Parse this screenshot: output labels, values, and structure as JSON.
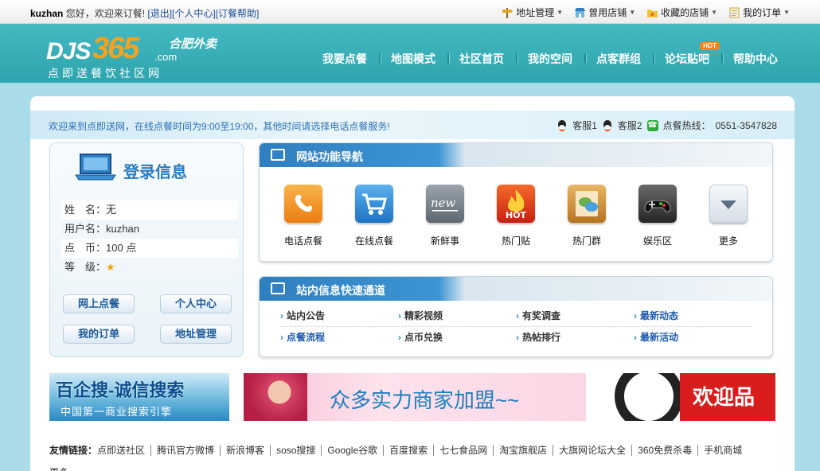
{
  "topbar": {
    "username": "kuzhan",
    "greeting": "您好，欢迎来订餐!",
    "links": [
      "[退出]",
      "[个人中心]",
      "[订餐帮助]"
    ],
    "tools": [
      {
        "label": "地址管理",
        "icon": "signpost-icon"
      },
      {
        "label": "曾用店铺",
        "icon": "shop-icon"
      },
      {
        "label": "收藏的店铺",
        "icon": "favorite-folder-icon"
      },
      {
        "label": "我的订单",
        "icon": "order-list-icon"
      }
    ]
  },
  "logo": {
    "djs": "DJS",
    "n365": "365",
    "com": ".com",
    "city": "合肥外卖",
    "slogan": "点即送餐饮社区网"
  },
  "nav": {
    "items": [
      "我要点餐",
      "地图模式",
      "社区首页",
      "我的空间",
      "点客群组",
      "论坛贴吧",
      "帮助中心"
    ],
    "hot_badge": "HOT"
  },
  "welcome": {
    "message": "欢迎来到点即送网，在线点餐时间为9:00至19:00，其他时间请选择电话点餐服务!",
    "service1": "客服1",
    "service2": "客服2",
    "hotline_label": "点餐热线：",
    "hotline": "0551-3547828"
  },
  "login": {
    "title": "登录信息",
    "name_label": "姓　名：",
    "name_value": "无",
    "user_label": "用户名：",
    "user_value": "kuzhan",
    "coin_label": "点　币：",
    "coin_value": "100 点",
    "level_label": "等　级：",
    "level_stars": 1,
    "buttons": [
      "网上点餐",
      "个人中心",
      "我的订单",
      "地址管理"
    ]
  },
  "functions": {
    "title": "网站功能导航",
    "items": [
      {
        "label": "电话点餐",
        "icon": "phone-icon",
        "color": "#f39a1c"
      },
      {
        "label": "在线点餐",
        "icon": "cart-icon",
        "color": "#2f8fd6"
      },
      {
        "label": "新鲜事",
        "icon": "new-icon",
        "color": "#7c8892"
      },
      {
        "label": "热门贴",
        "icon": "hot-flame-icon",
        "color": "#e23a1c"
      },
      {
        "label": "热门群",
        "icon": "chat-book-icon",
        "color": "#d48b2a"
      },
      {
        "label": "娱乐区",
        "icon": "gamepad-icon",
        "color": "#3b3b3b"
      },
      {
        "label": "更多",
        "icon": "more-down-icon",
        "color": "#dfe6ee"
      }
    ]
  },
  "quick": {
    "title": "站内信息快速通道",
    "rows": [
      [
        "站内公告",
        "精彩视频",
        "有奖调查",
        "最新动态"
      ],
      [
        "点餐流程",
        "点币兑换",
        "热帖排行",
        "最新活动"
      ]
    ]
  },
  "banners": {
    "b1_title": "百企搜-诚信搜索",
    "b1_sub": "中国第一商业搜索引擎",
    "b2_text": "众多实力商家加盟~~",
    "b3_text": "欢迎品"
  },
  "friends": {
    "label": "友情链接：",
    "links": [
      "点即送社区",
      "腾讯官方微博",
      "新浪博客",
      "soso搜搜",
      "Google谷歌",
      "百度搜索",
      "七七食品网",
      "淘宝旗舰店",
      "大旗网论坛大全",
      "360免费杀毒",
      "手机商城"
    ],
    "more": "更多"
  }
}
